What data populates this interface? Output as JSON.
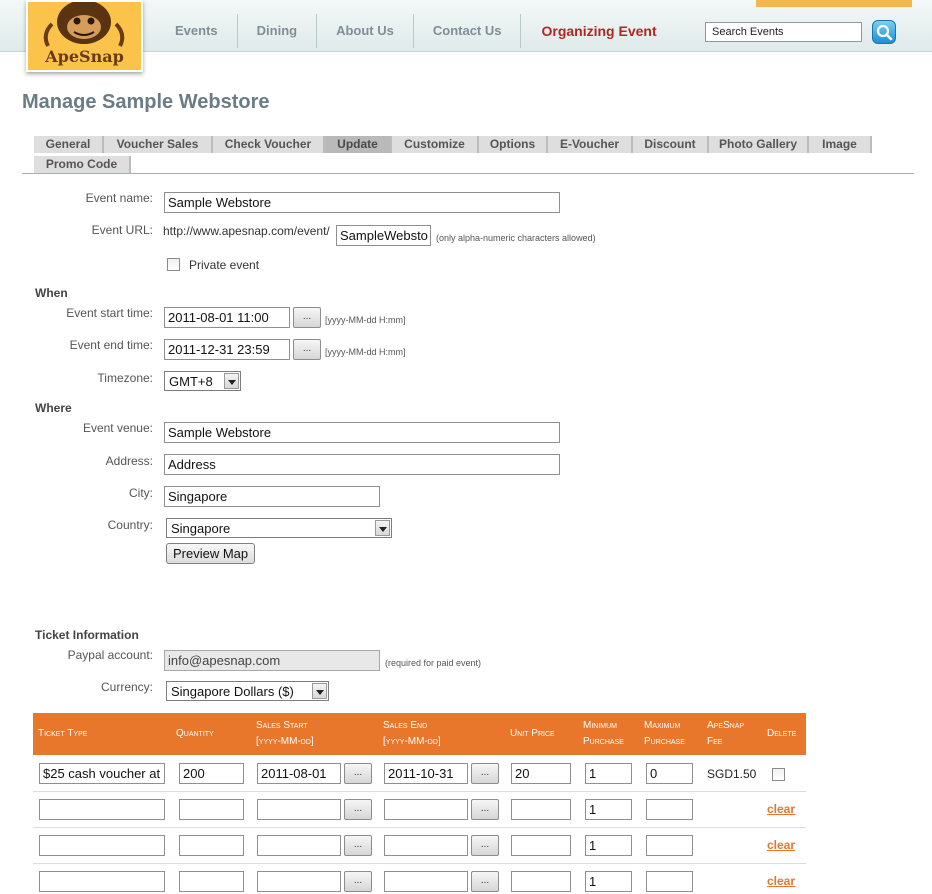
{
  "header": {
    "logo_text": "ApeSnap",
    "nav": [
      "Events",
      "Dining",
      "About Us",
      "Contact Us",
      "Organizing Event"
    ],
    "search_placeholder": "Search Events"
  },
  "page_title": "Manage Sample Webstore",
  "tabs": [
    "General",
    "Voucher Sales",
    "Check Voucher",
    "Update",
    "Customize",
    "Options",
    "E-Voucher",
    "Discount",
    "Photo Gallery",
    "Image",
    "Promo Code"
  ],
  "active_tab": "Update",
  "form": {
    "event_name_label": "Event name:",
    "event_name": "Sample Webstore",
    "event_url_label": "Event URL:",
    "event_url_prefix": "http://www.apesnap.com/event/",
    "event_url_value": "SampleWebsto",
    "event_url_hint": "(only alpha-numeric characters allowed)",
    "private_event_label": "Private event",
    "when_heading": "When",
    "start_time_label": "Event start time:",
    "start_time": "2011-08-01 11:00",
    "end_time_label": "Event end time:",
    "end_time": "2011-12-31 23:59",
    "datetime_hint": "[yyyy-MM-dd H:mm]",
    "picker_label": "...",
    "timezone_label": "Timezone:",
    "timezone": "GMT+8",
    "where_heading": "Where",
    "venue_label": "Event venue:",
    "venue": "Sample Webstore",
    "address_label": "Address:",
    "address": "Address",
    "city_label": "City:",
    "city": "Singapore",
    "country_label": "Country:",
    "country": "Singapore",
    "preview_map": "Preview Map"
  },
  "ticket_info": {
    "heading": "Ticket Information",
    "paypal_label": "Paypal account:",
    "paypal": "info@apesnap.com",
    "paypal_hint": "(required for paid event)",
    "currency_label": "Currency:",
    "currency": "Singapore Dollars ($)",
    "columns": {
      "ticket_type": "Ticket Type",
      "quantity": "Quantity",
      "sales_start": "Sales Start",
      "sales_end": "Sales End",
      "date_format": "[yyyy-MM-dd]",
      "unit_price": "Unit Price",
      "minimum": "Minimum",
      "maximum": "Maximum",
      "purchase": "Purchase",
      "apesnap": "ApeSnap",
      "fee": "Fee",
      "delete": "Delete"
    },
    "rows": [
      {
        "type": "$25 cash voucher at",
        "quantity": "200",
        "start": "2011-08-01",
        "end": "2011-10-31",
        "price": "20",
        "min": "1",
        "max": "0",
        "fee": "SGD1.50",
        "action": ""
      },
      {
        "type": "",
        "quantity": "",
        "start": "",
        "end": "",
        "price": "",
        "min": "1",
        "max": "",
        "fee": "",
        "action": "clear"
      },
      {
        "type": "",
        "quantity": "",
        "start": "",
        "end": "",
        "price": "",
        "min": "1",
        "max": "",
        "fee": "",
        "action": "clear"
      },
      {
        "type": "",
        "quantity": "",
        "start": "",
        "end": "",
        "price": "",
        "min": "1",
        "max": "",
        "fee": "",
        "action": "clear"
      }
    ]
  }
}
